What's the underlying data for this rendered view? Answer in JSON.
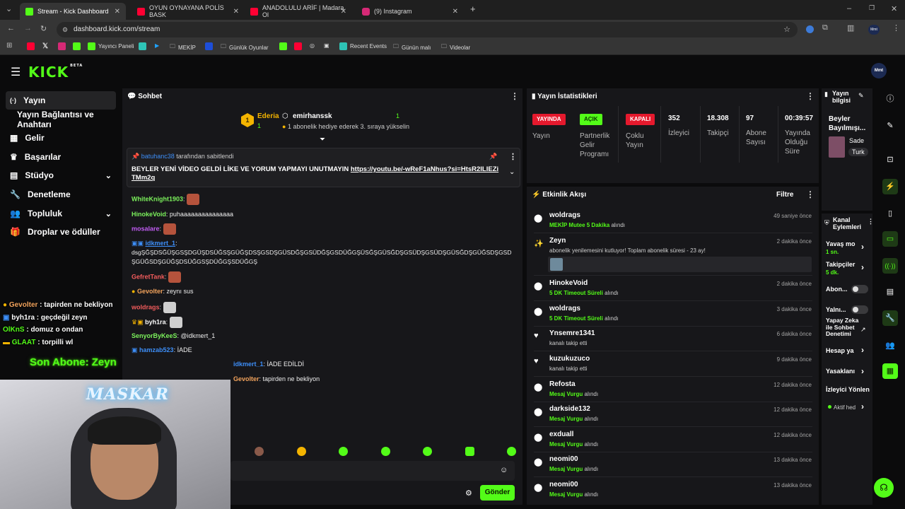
{
  "browser": {
    "tabs": [
      {
        "title": "Stream - Kick Dashboard",
        "active": true,
        "favicon": "kick",
        "color": "#53fc18"
      },
      {
        "title": "OYUN OYNAYANA POLİS BASK",
        "active": false,
        "favicon": "youtube",
        "color": "#ff0033"
      },
      {
        "title": "ANADOLULU ARİF | Madara Ol",
        "active": false,
        "favicon": "youtube",
        "color": "#ff0033"
      },
      {
        "title": "(9) Instagram",
        "active": false,
        "favicon": "instagram",
        "color": "#d62976"
      }
    ],
    "new_tab": "+",
    "url": "dashboard.kick.com/stream",
    "bookmarks": [
      {
        "label": "",
        "icon": "youtube"
      },
      {
        "label": "",
        "icon": "x"
      },
      {
        "label": "",
        "icon": "instagram"
      },
      {
        "label": "Yayıncı Paneli",
        "icon": "kick"
      },
      {
        "label": "",
        "icon": "app"
      },
      {
        "label": "",
        "icon": "prime"
      },
      {
        "label": "MEKİP",
        "icon": "folder"
      },
      {
        "label": "",
        "icon": "app2"
      },
      {
        "label": "Günlük Oyunlar",
        "icon": "folder"
      },
      {
        "label": "",
        "icon": "kick"
      },
      {
        "label": "",
        "icon": "youtube"
      },
      {
        "label": "",
        "icon": "globe"
      },
      {
        "label": "",
        "icon": "image"
      },
      {
        "label": "Recent Events",
        "icon": "app"
      },
      {
        "label": "Günün malı",
        "icon": "folder"
      },
      {
        "label": "Videolar",
        "icon": "folder"
      }
    ]
  },
  "app": {
    "logo": "KICK",
    "logo_badge": "BETA",
    "avatar": "Mmt",
    "sidebar": [
      {
        "label": "Yayın",
        "icon": "broadcast-icon",
        "active": true
      },
      {
        "label": "Yayın Bağlantısı ve Anahtarı",
        "icon": "",
        "active": false
      },
      {
        "label": "Gelir",
        "icon": "money-icon",
        "active": false
      },
      {
        "label": "Başarılar",
        "icon": "trophy-icon",
        "active": false
      },
      {
        "label": "Stüdyo",
        "icon": "studio-icon",
        "active": false,
        "chevron": true
      },
      {
        "label": "Denetleme",
        "icon": "wrench-icon",
        "active": false
      },
      {
        "label": "Topluluk",
        "icon": "community-icon",
        "active": false,
        "chevron": true
      },
      {
        "label": "Droplar ve ödüller",
        "icon": "gift-icon",
        "active": false
      }
    ],
    "chat": {
      "title": "Sohbet",
      "top_gifter": {
        "rank": "1",
        "name": "Ederia",
        "count": "1",
        "name_color": "#f4b400"
      },
      "gift_event": {
        "name": "emirhanssk",
        "count": "1",
        "text": "1 abonelik hediye ederek 3. sıraya yükselin"
      },
      "pinned": {
        "by_user": "batuhanc38",
        "by_text": "tarafından sabitlendi",
        "text": "BEYLER YENİ VİDEO GELDİ LİKE VE YORUM YAPMAYI UNUTMAYIN",
        "link": "https://youtu.be/-wReF1aNhus?si=HtsR2ILIEZiTMm2q"
      },
      "messages": [
        {
          "user": "WhiteKnight1903",
          "color": "#7cf25c",
          "text": "",
          "emote": true
        },
        {
          "user": "HinokeVoid",
          "color": "#7cf25c",
          "text": "puhaaaaaaaaaaaaaaa",
          "emote": false
        },
        {
          "user": "mosalare",
          "color": "#c05cf2",
          "text": "",
          "emote": true
        },
        {
          "user": "idkmert_1",
          "color": "#3d8ef7",
          "text": "dsgŞĞŞDSĞÜŞGSŞDGÜŞDSÜĞSŞGÜĞŞDSŞGSDŞGÜSDĞŞGSÜDĞŞGSDÜĞGŞÜSĞŞGÜSĞDŞGSÜDŞGSÜDŞGÜSĞDŞGÜĞSDŞGSDŞGÜĞSDŞGÜĞŞDSÜĞGSŞDÜĞGŞSDÜĞGŞ",
          "emote": false
        },
        {
          "user": "GefretTank",
          "color": "#f25c5c",
          "text": "",
          "emote": true
        },
        {
          "user": "Gevolter",
          "color": "#f2a35c",
          "text": "zeynı sus",
          "emote": false
        },
        {
          "user": "woldrags",
          "color": "#f25c5c",
          "text": "",
          "emote": true
        },
        {
          "user": "byh1ra",
          "color": "#ffffff",
          "text": "",
          "emote": true
        },
        {
          "user": "SenyorByKeeS",
          "color": "#7cf25c",
          "text": "@idkmert_1",
          "emote": false
        },
        {
          "user": "hamzab523",
          "color": "#3d8ef7",
          "text": "İADE",
          "emote": false
        },
        {
          "user": "idkmert_1",
          "color": "#3d8ef7",
          "text": "İADE EDİLDİ",
          "emote": false
        },
        {
          "user": "Gevolter",
          "color": "#f2a35c",
          "text": "tapirden ne bekliyon",
          "emote": false
        }
      ],
      "send_button": "Gönder"
    },
    "stats": {
      "title": "Yayın İstatistikleri",
      "items": [
        {
          "badge": "YAYINDA",
          "badge_bg": "#e5192d",
          "badge_fg": "#ffffff",
          "label": "Yayın"
        },
        {
          "badge": "AÇIK",
          "badge_bg": "#53fc18",
          "badge_fg": "#0b3b00",
          "label": "Partnerlik Gelir Programı"
        },
        {
          "badge": "KAPALI",
          "badge_bg": "#e5192d",
          "badge_fg": "#ffffff",
          "label": "Çoklu Yayın"
        },
        {
          "value": "352",
          "label": "İzleyici"
        },
        {
          "value": "18.308",
          "label": "Takipçi"
        },
        {
          "value": "97",
          "label": "Abone Sayısı"
        },
        {
          "value": "00:39:57",
          "label": "Yayında Olduğu Süre"
        }
      ]
    },
    "activity": {
      "title": "Etkinlik Akışı",
      "filter": "Filtre",
      "items": [
        {
          "name": "woldrags",
          "sub_green": "MEKİP Mutee 5 Dakika",
          "sub": "alındı",
          "time": "49 saniye önce",
          "icon": "coins-icon"
        },
        {
          "name": "Zeyn",
          "sub_green": "",
          "sub": "abonelik yenilemesini kutluyor! Toplam abonelik süresi - 23 ay!",
          "time": "2 dakika önce",
          "icon": "star-icon"
        },
        {
          "name": "HinokeVoid",
          "sub_green": "5 DK Timeout Süreli",
          "sub": "alındı",
          "time": "2 dakika önce",
          "icon": "coins-icon"
        },
        {
          "name": "woldrags",
          "sub_green": "5 DK Timeout Süreli",
          "sub": "alındı",
          "time": "3 dakika önce",
          "icon": "coins-icon"
        },
        {
          "name": "Ynsemre1341",
          "sub_green": "",
          "sub": "kanalı takip etti",
          "time": "6 dakika önce",
          "icon": "heart-icon"
        },
        {
          "name": "kuzukuzuco",
          "sub_green": "",
          "sub": "kanalı takip etti",
          "time": "9 dakika önce",
          "icon": "heart-icon"
        },
        {
          "name": "Refosta",
          "sub_green": "Mesaj Vurgu",
          "sub": "alındı",
          "time": "12 dakika önce",
          "icon": "coins-icon"
        },
        {
          "name": "darkside132",
          "sub_green": "Mesaj Vurgu",
          "sub": "alındı",
          "time": "12 dakika önce",
          "icon": "coins-icon"
        },
        {
          "name": "exduall",
          "sub_green": "Mesaj Vurgu",
          "sub": "alındı",
          "time": "12 dakika önce",
          "icon": "coins-icon"
        },
        {
          "name": "neomi00",
          "sub_green": "Mesaj Vurgu",
          "sub": "alındı",
          "time": "13 dakika önce",
          "icon": "coins-icon"
        },
        {
          "name": "neomi00",
          "sub_green": "Mesaj Vurgu",
          "sub": "alındı",
          "time": "13 dakika önce",
          "icon": "coins-icon"
        }
      ]
    },
    "stream_info": {
      "title": "Yayın bilgisi",
      "stream_title": "Beyler Bayılmışı...",
      "category": "Sade",
      "language": "Turk"
    },
    "channel_actions": {
      "title": "Kanal Eylemleri",
      "slow_mode": {
        "label": "Yavaş mo",
        "value": "1 sn."
      },
      "followers": {
        "label": "Takipçiler",
        "value": "5 dk."
      },
      "subs": "Abon...",
      "emotes": "Yalnı...",
      "ai_mod": "Yapay Zeka ile Sohbet Denetimi",
      "account_age": "Hesap ya",
      "bans": "Yasaklanı",
      "viewer_redirect": "İzleyici Yönlen",
      "active": "Aktif hed"
    },
    "overlay": {
      "messages": [
        {
          "user": "Gevolter",
          "text": "tapirden ne bekliyon",
          "color": "#f2a35c"
        },
        {
          "user": "byh1ra",
          "text": "geçdeğil zeyn",
          "color": "#ffffff"
        },
        {
          "user": "OlKnS",
          "text": "domuz o ondan",
          "color": "#53fc18"
        },
        {
          "user": "GLAAT",
          "text": "torpilli wl",
          "color": "#53fc18"
        }
      ],
      "last_sub_label": "Son Abone: Zeyn",
      "cam_text": "MASKAR"
    }
  }
}
